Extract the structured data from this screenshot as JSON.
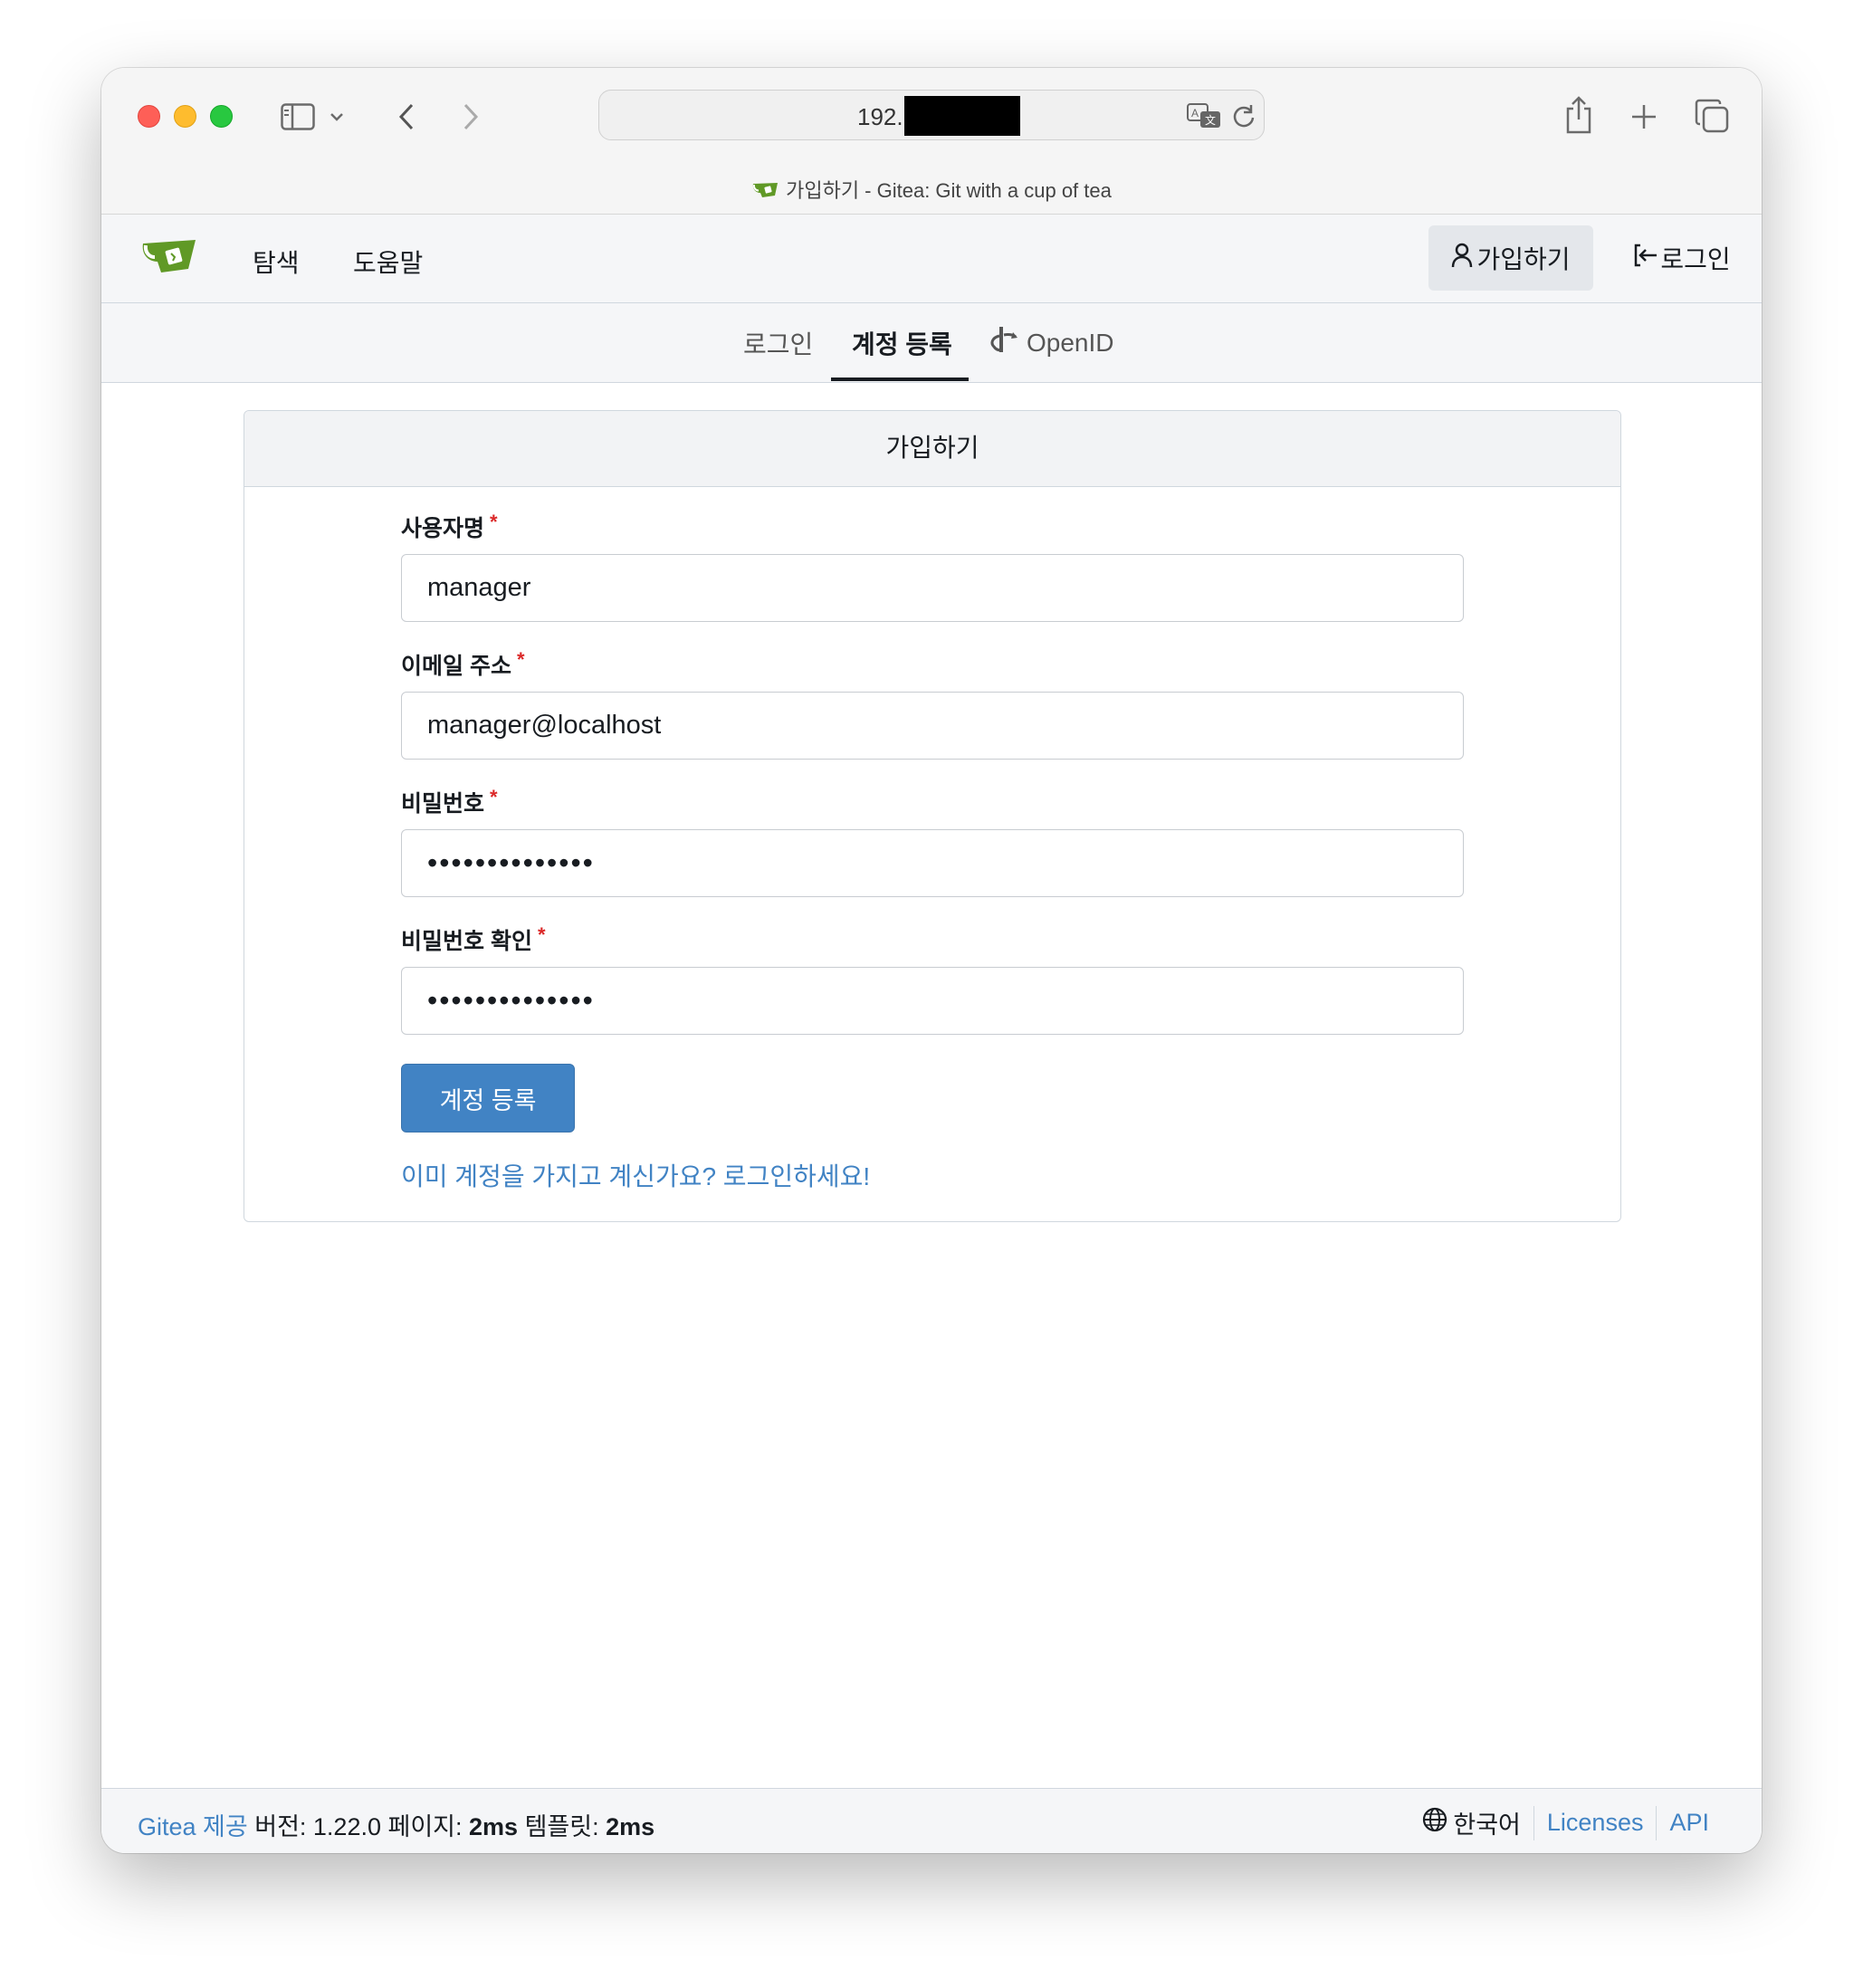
{
  "browser": {
    "address_prefix": "192.",
    "tab_title": "가입하기 - Gitea: Git with a cup of tea"
  },
  "navbar": {
    "explore": "탐색",
    "help": "도움말",
    "signup": "가입하기",
    "signin": "로그인"
  },
  "subnav": {
    "tabs": [
      {
        "label": "로그인"
      },
      {
        "label": "계정 등록"
      },
      {
        "label": "OpenID"
      }
    ]
  },
  "form": {
    "title": "가입하기",
    "username_label": "사용자명",
    "username_value": "manager",
    "email_label": "이메일 주소",
    "email_value": "manager@localhost",
    "password_label": "비밀번호",
    "password_value": "••••••••••••••",
    "confirm_label": "비밀번호 확인",
    "confirm_value": "••••••••••••••",
    "required_mark": "*",
    "submit_label": "계정 등록",
    "signin_link": "이미 계정을 가지고 계신가요? 로그인하세요!"
  },
  "footer": {
    "powered_by": "Gitea 제공",
    "version_text": "버전: 1.22.0 페이지:",
    "page_time": "2ms",
    "template_label": "템플릿:",
    "template_time": "2ms",
    "language": "한국어",
    "licenses": "Licenses",
    "api": "API"
  },
  "colors": {
    "accent": "#4183c4",
    "required": "#db2828",
    "gitea_green": "#609926"
  }
}
